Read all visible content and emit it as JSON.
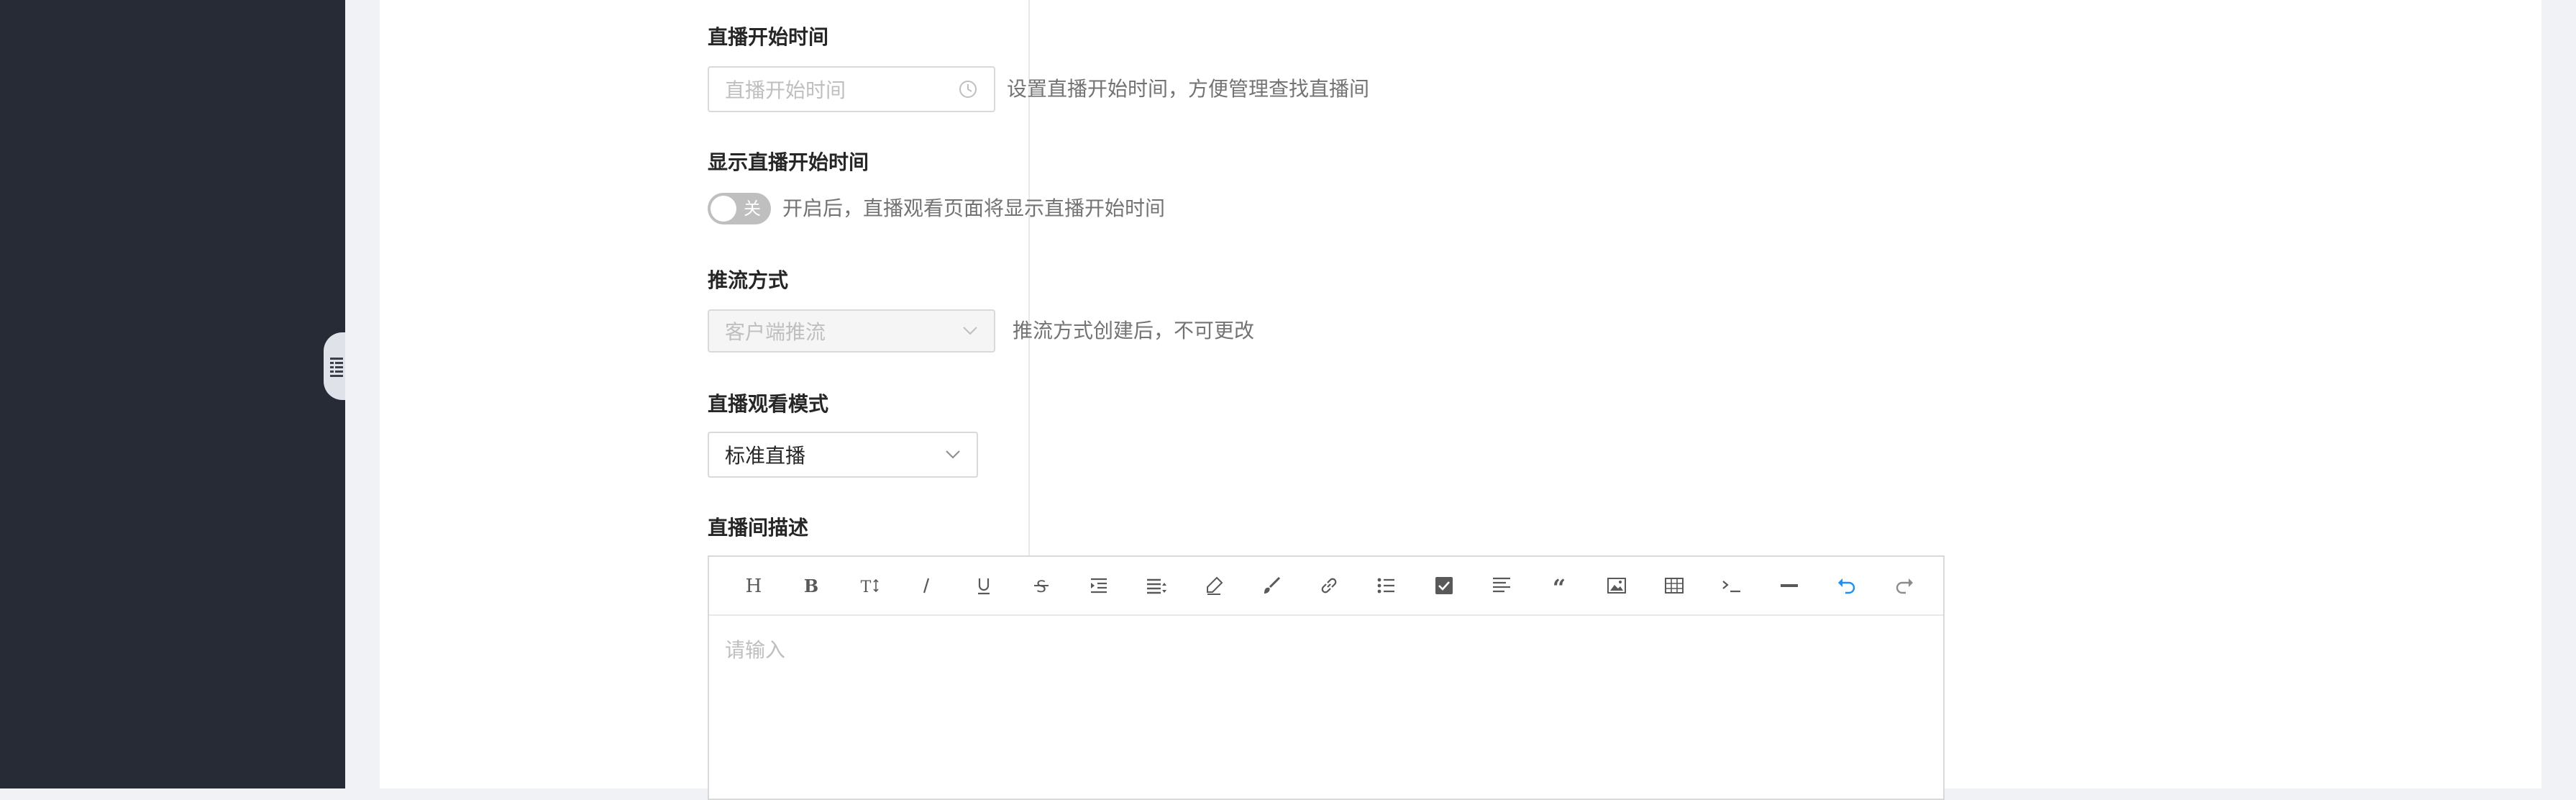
{
  "sidebar": {
    "collapse_icon": "menu-fold-icon"
  },
  "form": {
    "start_time": {
      "label": "直播开始时间",
      "placeholder": "直播开始时间",
      "icon": "clock-icon",
      "hint": "设置直播开始时间，方便管理查找直播间"
    },
    "show_start_time": {
      "label": "显示直播开始时间",
      "switch_text": "关",
      "switch_on": false,
      "hint": "开启后，直播观看页面将显示直播开始时间"
    },
    "push_mode": {
      "label": "推流方式",
      "value": "客户端推流",
      "disabled": true,
      "hint": "推流方式创建后，不可更改"
    },
    "watch_mode": {
      "label": "直播观看模式",
      "value": "标准直播"
    },
    "description": {
      "label": "直播间描述",
      "placeholder": "请输入",
      "toolbar": [
        "heading-icon",
        "bold-icon",
        "font-size-icon",
        "italic-icon",
        "underline-icon",
        "strikethrough-icon",
        "indent-icon",
        "line-height-icon",
        "highlight-icon",
        "brush-icon",
        "link-icon",
        "bulleted-list-icon",
        "checkbox-icon",
        "align-left-icon",
        "quote-icon",
        "image-icon",
        "table-icon",
        "code-icon",
        "horizontal-rule-icon",
        "undo-icon",
        "redo-icon"
      ]
    }
  },
  "colors": {
    "sidebar": "#272b36",
    "accent": "#1890ff",
    "label": "#262626",
    "hint": "#737373"
  }
}
